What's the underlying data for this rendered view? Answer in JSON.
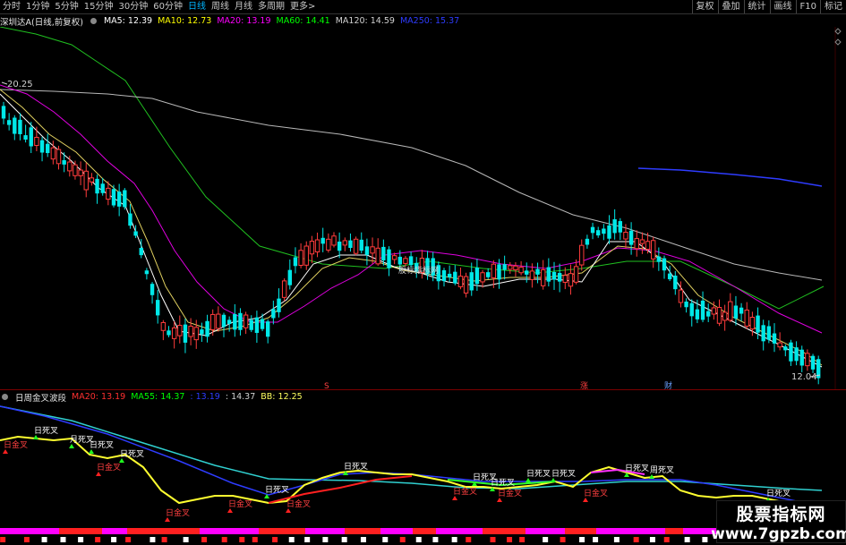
{
  "toolbar": {
    "periods": [
      "分时",
      "1分钟",
      "5分钟",
      "15分钟",
      "30分钟",
      "60分钟",
      "日线",
      "周线",
      "月线",
      "多周期",
      "更多>"
    ],
    "active_period": "日线",
    "right_buttons": [
      "复权",
      "叠加",
      "统计",
      "画线",
      "F10",
      "标记"
    ]
  },
  "main_legend": {
    "title": "深圳达A(日线,前复权)",
    "items": [
      {
        "label": "MA5: 12.39",
        "color": "#ffffff"
      },
      {
        "label": "MA10: 12.73",
        "color": "#ffff00"
      },
      {
        "label": "MA20: 13.19",
        "color": "#ff00ff"
      },
      {
        "label": "MA60: 14.41",
        "color": "#00ff00"
      },
      {
        "label": "MA120: 14.59",
        "color": "#d0d0d0"
      },
      {
        "label": "MA250: 15.37",
        "color": "#2e3cff"
      }
    ]
  },
  "main_chart": {
    "high_label": "20.25",
    "low_label": "12.04",
    "center_text": "股标指标网",
    "markers": [
      {
        "text": "S",
        "color": "#ff4040"
      },
      {
        "text": "涨",
        "color": "#ff4040"
      },
      {
        "text": "财",
        "color": "#6aa0ff"
      }
    ]
  },
  "sub_legend": {
    "title": "日周金叉波段",
    "items": [
      {
        "label": "MA20: 13.19",
        "color": "#ff3030"
      },
      {
        "label": "MA55: 14.37",
        "color": "#00ff00"
      },
      {
        "label": ": 13.19",
        "color": "#2e3cff"
      },
      {
        "label": ": 14.37",
        "color": "#d0d0d0"
      },
      {
        "label": "BB: 12.25",
        "color": "#ffff60"
      }
    ]
  },
  "sub_chart": {
    "signals": [
      {
        "text": "日死叉",
        "color": "#ffffff"
      },
      {
        "text": "月死叉",
        "color": "#ffffff"
      },
      {
        "text": "日金叉",
        "color": "#ff4040"
      },
      {
        "text": "周死叉",
        "color": "#ffffff"
      }
    ]
  },
  "watermark": {
    "line1": "股票指标网",
    "line2": "www.7gpzb.com"
  }
}
